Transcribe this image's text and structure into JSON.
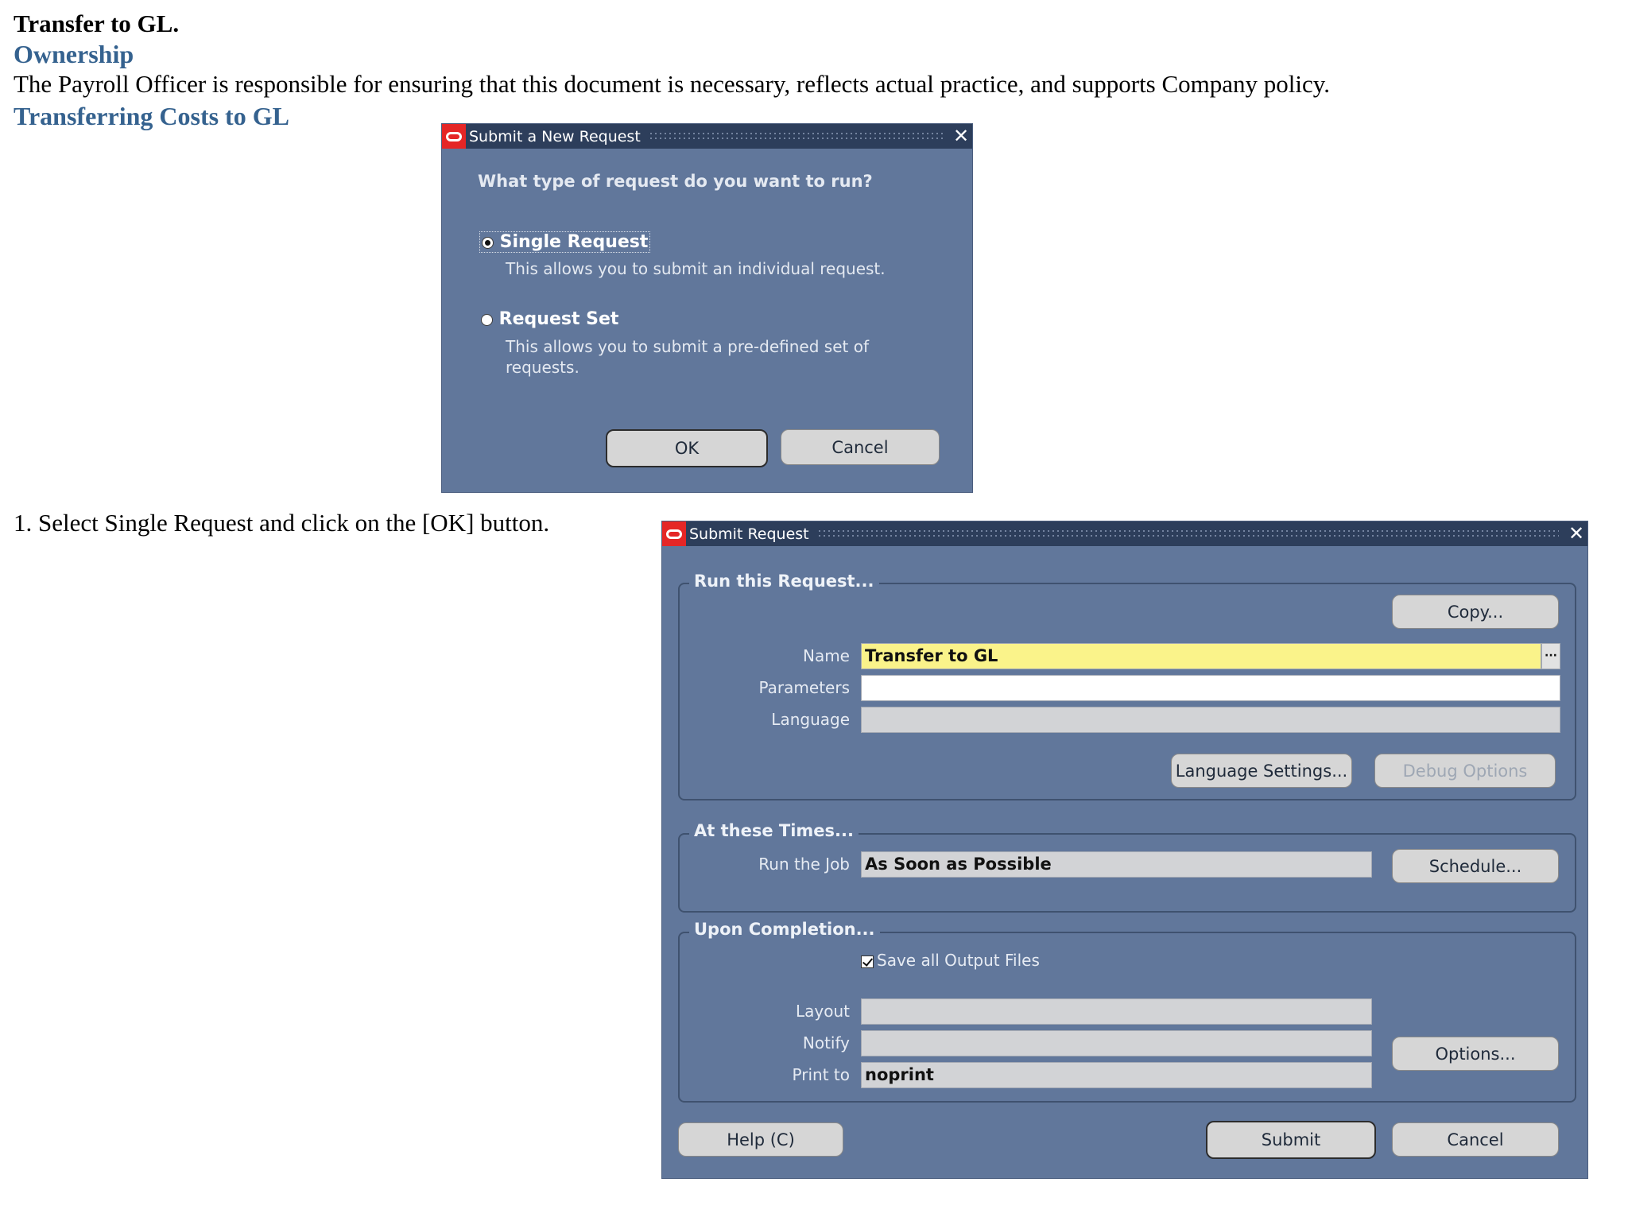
{
  "doc": {
    "title": "Transfer to GL.",
    "heading_ownership": "Ownership",
    "paragraph": "The Payroll Officer is responsible for ensuring that this document is necessary, reflects actual practice, and supports Company  policy.",
    "heading_transfer": "Transferring Costs to GL",
    "step": "1. Select Single Request and click on the [OK] button."
  },
  "new_request_dialog": {
    "title": "Submit a New Request",
    "question": "What type of request do you want to run?",
    "single": {
      "label": "Single Request",
      "desc": "This allows you to submit an individual request.",
      "selected": true
    },
    "set": {
      "label": "Request Set",
      "desc_line1": "This allows you to submit a pre-defined set of",
      "desc_line2": "requests.",
      "selected": false
    },
    "ok_label": "OK",
    "cancel_label": "Cancel"
  },
  "submit_request": {
    "title": "Submit Request",
    "run_group": {
      "title": "Run this Request...",
      "copy_label": "Copy...",
      "name_label": "Name",
      "name_value": "Transfer to GL",
      "parameters_label": "Parameters",
      "parameters_value": "",
      "language_label": "Language",
      "language_value": "",
      "language_settings_label": "Language Settings...",
      "debug_options_label": "Debug Options"
    },
    "times_group": {
      "title": "At these Times...",
      "run_job_label": "Run the Job",
      "run_job_value": "As Soon as Possible",
      "schedule_label": "Schedule..."
    },
    "completion_group": {
      "title": "Upon Completion...",
      "save_output_label": "Save all Output Files",
      "save_output_checked": true,
      "layout_label": "Layout",
      "layout_value": "",
      "notify_label": "Notify",
      "notify_value": "",
      "print_to_label": "Print to",
      "print_to_value": "noprint",
      "options_label": "Options..."
    },
    "help_label": "Help (C)",
    "submit_label": "Submit",
    "cancel_label": "Cancel"
  }
}
